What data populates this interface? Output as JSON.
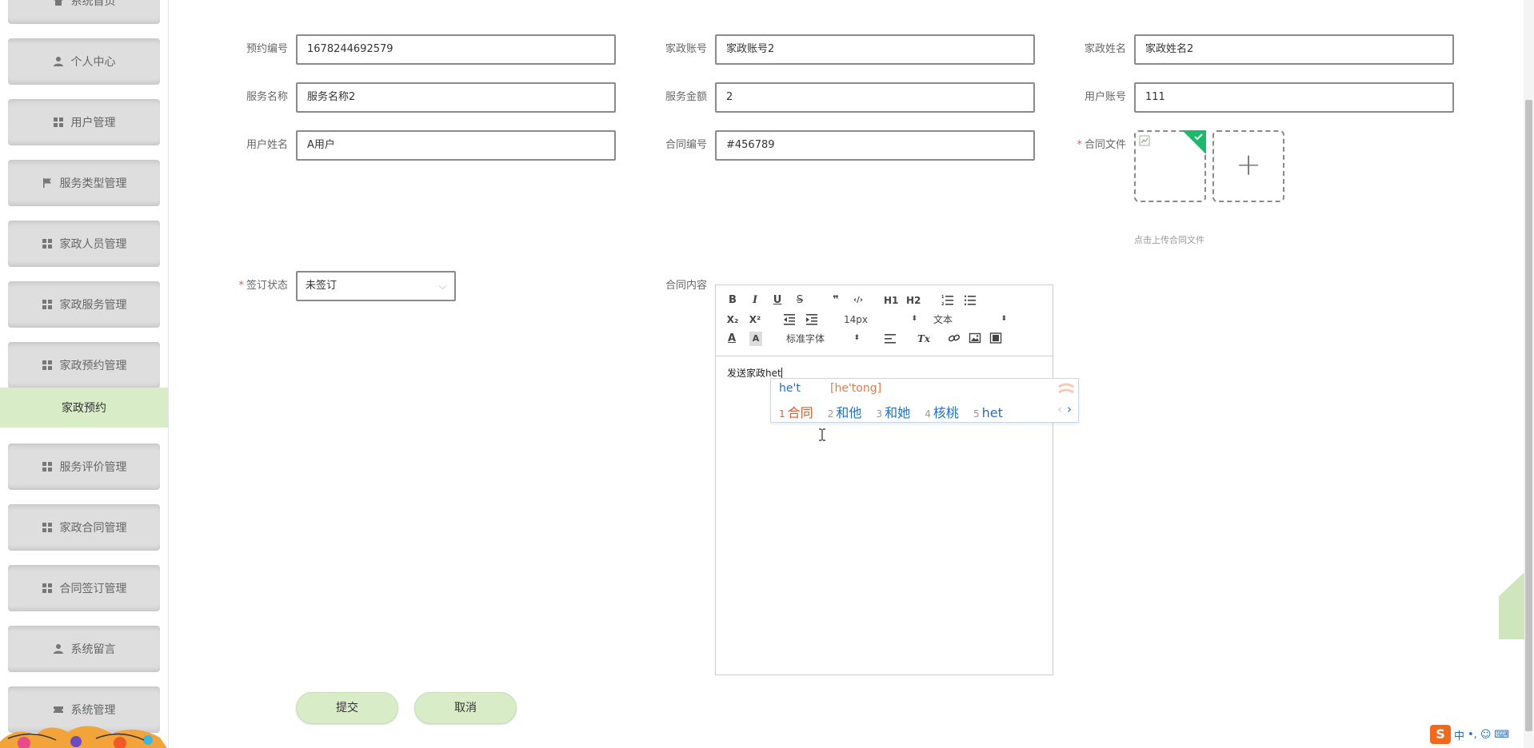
{
  "sidebar": {
    "items": [
      {
        "label": "系统首页",
        "icon": "home-icon"
      },
      {
        "label": "个人中心",
        "icon": "person-icon"
      },
      {
        "label": "用户管理",
        "icon": "grid-icon"
      },
      {
        "label": "服务类型管理",
        "icon": "flag-icon"
      },
      {
        "label": "家政人员管理",
        "icon": "grid-icon"
      },
      {
        "label": "家政服务管理",
        "icon": "grid-icon"
      },
      {
        "label": "家政预约管理",
        "icon": "grid-icon"
      },
      {
        "label": "服务评价管理",
        "icon": "grid-icon"
      },
      {
        "label": "家政合同管理",
        "icon": "grid-icon"
      },
      {
        "label": "合同签订管理",
        "icon": "grid-icon"
      },
      {
        "label": "系统留言",
        "icon": "person-icon"
      },
      {
        "label": "系统管理",
        "icon": "ticket-icon"
      }
    ],
    "active_sub": "家政预约"
  },
  "form": {
    "booking_no": {
      "label": "预约编号",
      "value": "1678244692579"
    },
    "housekeeper_account": {
      "label": "家政账号",
      "value": "家政账号2"
    },
    "housekeeper_name": {
      "label": "家政姓名",
      "value": "家政姓名2"
    },
    "service_name": {
      "label": "服务名称",
      "value": "服务名称2"
    },
    "service_amount": {
      "label": "服务金额",
      "value": "2"
    },
    "user_account": {
      "label": "用户账号",
      "value": "111"
    },
    "user_name": {
      "label": "用户姓名",
      "value": "A用户"
    },
    "contract_no": {
      "label": "合同编号",
      "value": "#456789"
    },
    "contract_file": {
      "label": "合同文件",
      "hint": "点击上传合同文件",
      "add_symbol": "+"
    },
    "sign_status": {
      "label": "签订状态",
      "value": "未签订",
      "chevron": "⌵"
    },
    "contract_content": {
      "label": "合同内容",
      "typed": "发送家政het"
    }
  },
  "required_mark": "*",
  "editor": {
    "font_size": "14px",
    "text_format": "文本",
    "font_family": "标准字体",
    "buttons": [
      "bold",
      "italic",
      "underline",
      "strike",
      "blockquote",
      "code-block",
      "h1",
      "h2",
      "ordered-list",
      "bullet-list",
      "subscript",
      "superscript",
      "outdent",
      "indent",
      "color",
      "background",
      "align",
      "clean",
      "link",
      "image",
      "video"
    ],
    "glyphs": {
      "bold": "B",
      "italic": "I",
      "underline": "U",
      "strike": "S",
      "quote": "❞",
      "code": "‹/›",
      "h1": "H1",
      "h2": "H2",
      "sub": "X₂",
      "sup": "X²",
      "color": "A",
      "background": "A",
      "clean": "Tx",
      "updown": "⬍"
    }
  },
  "ime": {
    "composition": "he't",
    "pinyin": "[he'tong]",
    "candidates": [
      {
        "n": "1",
        "text": "合同"
      },
      {
        "n": "2",
        "text": "和他"
      },
      {
        "n": "3",
        "text": "和她"
      },
      {
        "n": "4",
        "text": "核桃"
      },
      {
        "n": "5",
        "text": "het"
      }
    ],
    "prev": "‹",
    "next": "›"
  },
  "buttons": {
    "submit": "提交",
    "cancel": "取消"
  },
  "tray": {
    "logo": "S",
    "mode": "中",
    "punct": "•,",
    "face": "☺",
    "keyboard": "⌨"
  },
  "colors": {
    "accent_green": "#d8ecc8",
    "required_red": "#e15c5c",
    "ime_blue": "#1e6fc7"
  }
}
